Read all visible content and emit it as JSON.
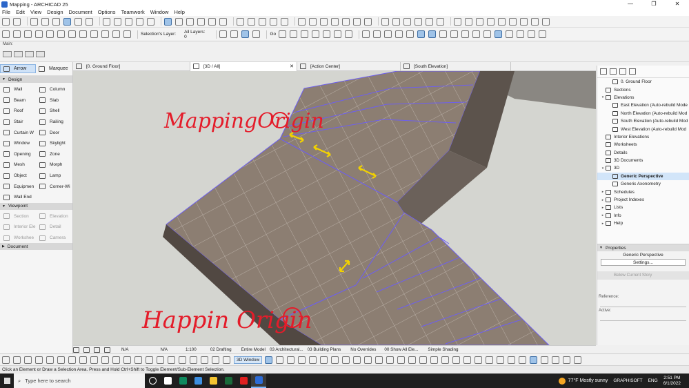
{
  "window": {
    "title": "Mapping - ARCHICAD 25",
    "controls": [
      "—",
      "❐",
      "✕"
    ]
  },
  "menu": [
    "File",
    "Edit",
    "View",
    "Design",
    "Document",
    "Options",
    "Teamwork",
    "Window",
    "Help"
  ],
  "toolbar": {
    "selection_layer_label": "Selection's Layer:",
    "selection_layer_value": "All Layers:",
    "selection_layer_count": "0",
    "goto_label": "Go"
  },
  "main_toolbar": {
    "caption": "Main:"
  },
  "toolbox": {
    "arrow": "Arrow",
    "marquee": "Marquee",
    "design_header": "Design",
    "design_tools": [
      "Wall",
      "Column",
      "Beam",
      "Slab",
      "Roof",
      "Shell",
      "Stair",
      "Railing",
      "Curtain W",
      "Door",
      "Window",
      "Skylight",
      "Opening",
      "Zone",
      "Mesh",
      "Morph",
      "Object",
      "Lamp",
      "Equipmen",
      "Corner-Wi",
      "Wall End"
    ],
    "viewpoint_header": "Viewpoint",
    "viewpoint_tools": [
      "Section",
      "Elevation",
      "Interior Ele",
      "Detail",
      "Workshee",
      "Camera"
    ],
    "document_header": "Document"
  },
  "tabs": [
    "[0. Ground Floor]",
    "[3D / All]",
    "[Action Center]",
    "[South Elevation]"
  ],
  "viewport": {
    "annotation_top": "MappingOrigin",
    "annotation_bottom": "Happin Origin"
  },
  "navigator": {
    "items": [
      {
        "label": "0. Ground Floor",
        "toggle": "",
        "indent": 2,
        "selected": false
      },
      {
        "label": "Sections",
        "toggle": "",
        "indent": 1,
        "selected": false
      },
      {
        "label": "Elevations",
        "toggle": "▾",
        "indent": 1,
        "selected": false
      },
      {
        "label": "East Elevation (Auto-rebuild Mode",
        "toggle": "",
        "indent": 2,
        "selected": false
      },
      {
        "label": "North Elevation (Auto-rebuild Mod",
        "toggle": "",
        "indent": 2,
        "selected": false
      },
      {
        "label": "South Elevation (Auto-rebuild Mod",
        "toggle": "",
        "indent": 2,
        "selected": false
      },
      {
        "label": "West Elevation (Auto-rebuild Mod",
        "toggle": "",
        "indent": 2,
        "selected": false
      },
      {
        "label": "Interior Elevations",
        "toggle": "",
        "indent": 1,
        "selected": false
      },
      {
        "label": "Worksheets",
        "toggle": "",
        "indent": 1,
        "selected": false
      },
      {
        "label": "Details",
        "toggle": "",
        "indent": 1,
        "selected": false
      },
      {
        "label": "3D Documents",
        "toggle": "",
        "indent": 1,
        "selected": false
      },
      {
        "label": "3D",
        "toggle": "▾",
        "indent": 1,
        "selected": false
      },
      {
        "label": "Generic Perspective",
        "toggle": "",
        "indent": 2,
        "selected": true
      },
      {
        "label": "Generic Axonometry",
        "toggle": "",
        "indent": 2,
        "selected": false
      },
      {
        "label": "Schedules",
        "toggle": "▸",
        "indent": 1,
        "selected": false
      },
      {
        "label": "Project Indexes",
        "toggle": "▸",
        "indent": 1,
        "selected": false
      },
      {
        "label": "Lists",
        "toggle": "▸",
        "indent": 1,
        "selected": false
      },
      {
        "label": "Info",
        "toggle": "▸",
        "indent": 1,
        "selected": false
      },
      {
        "label": "Help",
        "toggle": "▸",
        "indent": 1,
        "selected": false
      }
    ]
  },
  "properties": {
    "header": "Properties",
    "view_name": "Generic Perspective",
    "settings_button": "Settings...",
    "below_story": "Below Current Story",
    "reference_label": "Reference:",
    "active_label": "Active:"
  },
  "view_status": {
    "na1": "N/A",
    "na2": "N/A",
    "scale": "1:100",
    "layer_combo": "02 Drafting",
    "model_filter": "Entire Model",
    "layer_set": "03 Architectural...",
    "plan_set": "03 Building Plans",
    "override": "No Overrides",
    "show_elements": "00 Show All Ele...",
    "shading": "Simple Shading"
  },
  "bottom_toolbar": {
    "window_3d": "3D Window"
  },
  "status_hint": "Click an Element or Draw a Selection Area. Press and Hold Ctrl+Shift to Toggle Element/Sub-Element Selection.",
  "taskbar": {
    "search_placeholder": "Type here to search",
    "weather": "77°F  Mostly sunny",
    "lang": "ENG",
    "time": "2:51 PM",
    "date": "6/1/2022",
    "graphisoft": "GRAPHISOFT",
    "app_colors": [
      "#ffffff",
      "#0f8a5f",
      "#3d8fe0",
      "#f4c430",
      "#1a6b3a",
      "#e02020",
      "#2c6bd6"
    ]
  },
  "colors": {
    "tile": "#8c7e72",
    "grout": "#c9c0b8",
    "outline": "#6d5ff0",
    "arrow": "#f2d200",
    "ink": "#e41c2a",
    "selection": "#cfe2f7"
  }
}
